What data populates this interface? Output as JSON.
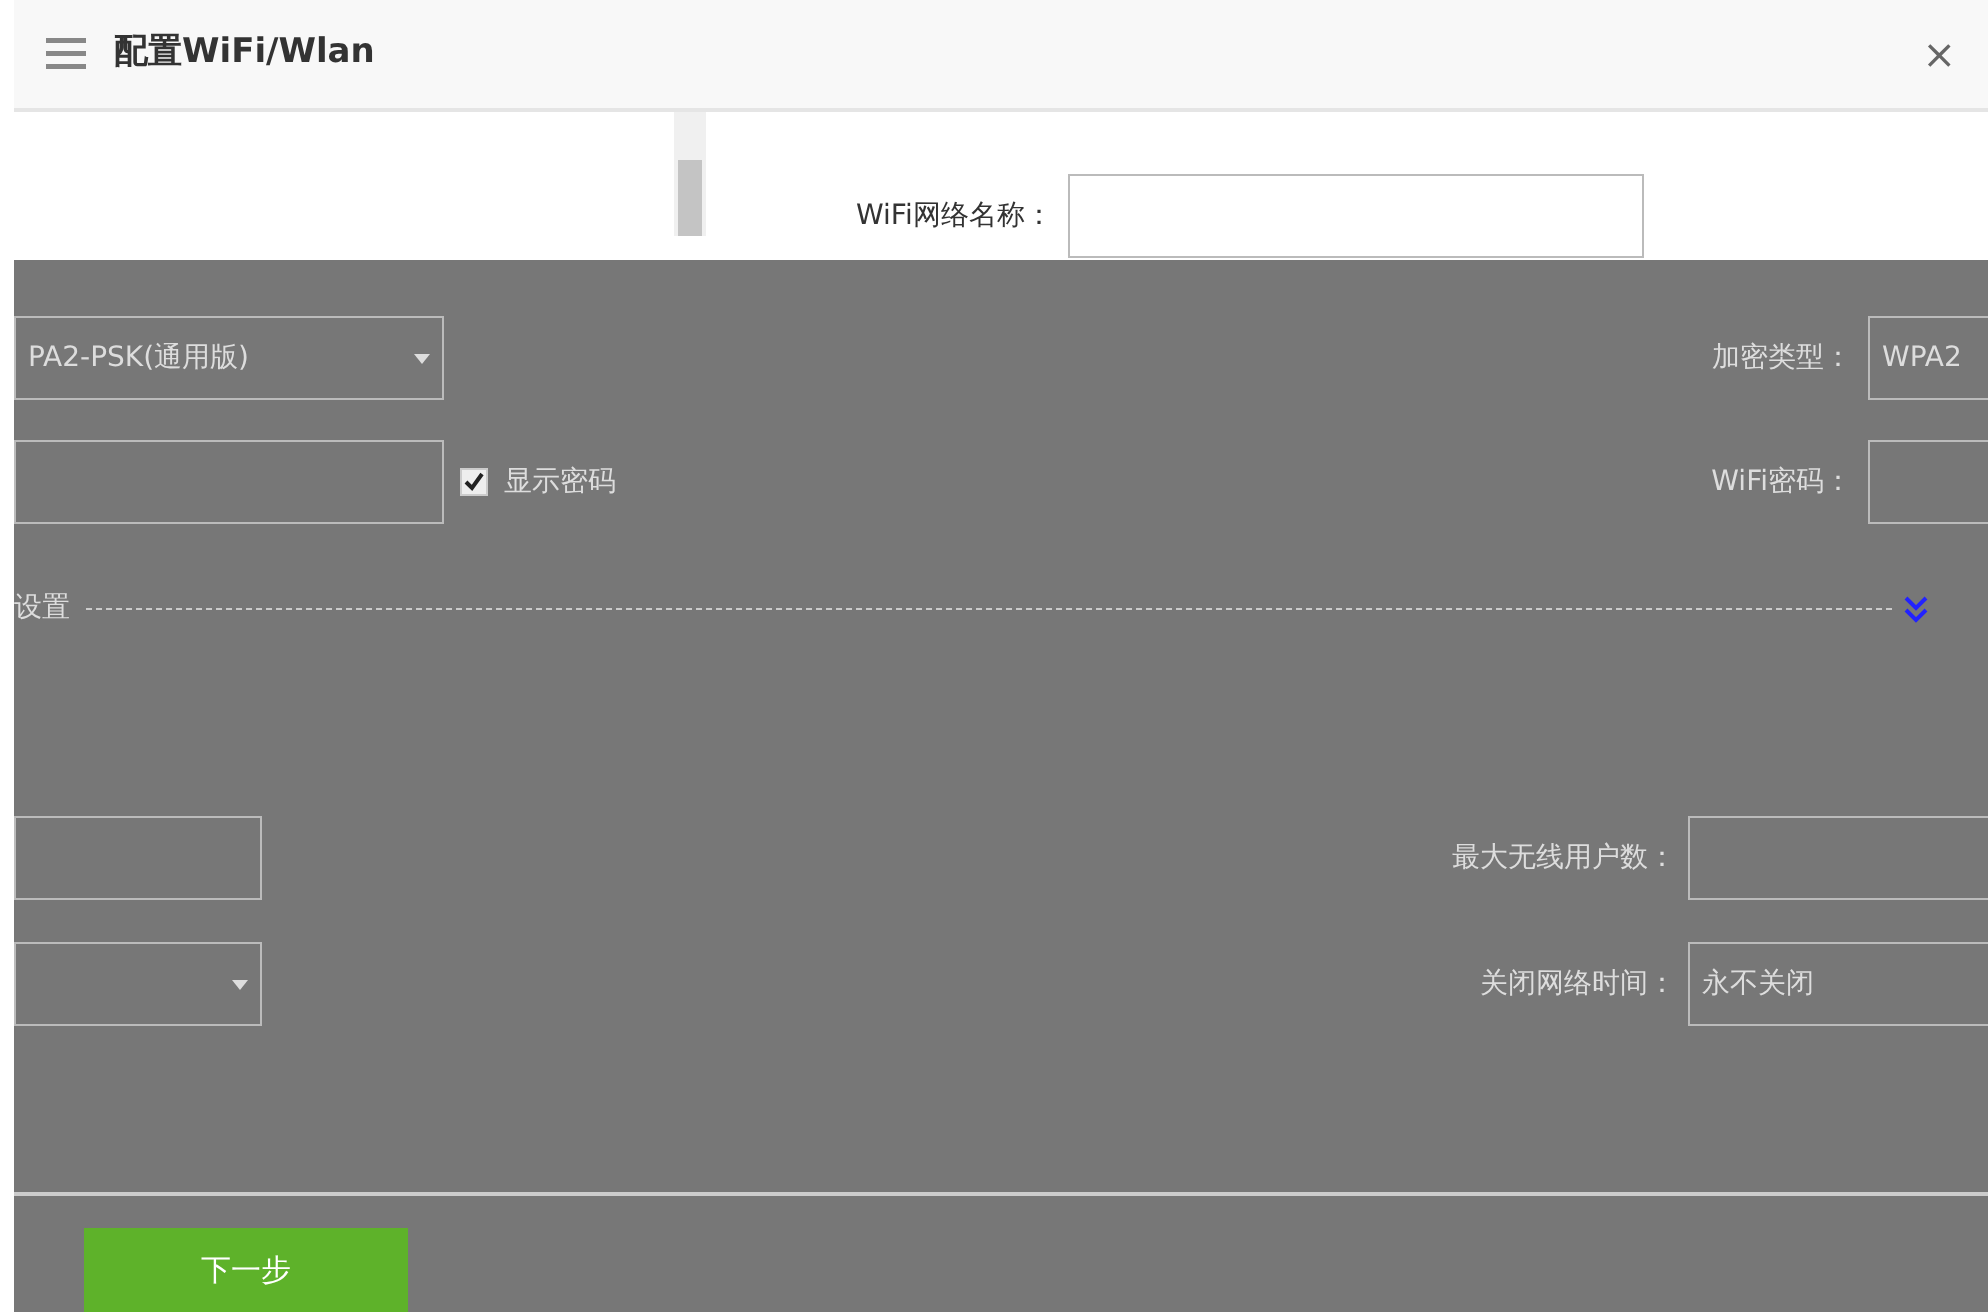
{
  "window": {
    "title": "配置WiFi/Wlan",
    "close": "×"
  },
  "wifi_name": {
    "label": "WiFi网络名称："
  },
  "encryption_select": {
    "value": "PA2-PSK(通用版)"
  },
  "encryption": {
    "label": "加密类型：",
    "value": "WPA2"
  },
  "show_password": {
    "label": "显示密码",
    "checked": true
  },
  "password": {
    "label": "WiFi密码："
  },
  "advanced": {
    "label": "设置",
    "expanded": false
  },
  "left_fields": [
    {
      "kind": "input"
    },
    {
      "kind": "select"
    }
  ],
  "right_fields": [
    {
      "label": "最大无线用户数："
    },
    {
      "label": "关闭网络时间：",
      "value": "永不关闭"
    }
  ],
  "next_button": "下一步"
}
